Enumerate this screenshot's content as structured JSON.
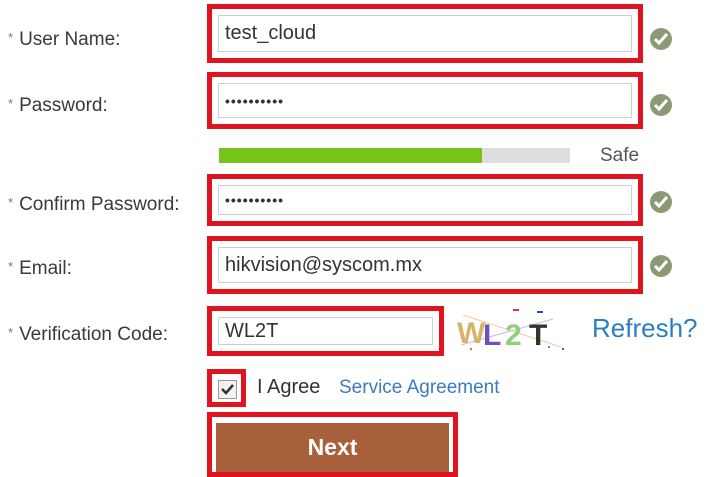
{
  "form": {
    "required_mark": "*",
    "username": {
      "label": "User Name:",
      "value": "test_cloud"
    },
    "password": {
      "label": "Password:",
      "value": "••••••••••"
    },
    "strength": {
      "label": "Safe",
      "level": 0.75,
      "color": "#76c31a"
    },
    "confirm_password": {
      "label": "Confirm Password:",
      "value": "••••••••••"
    },
    "email": {
      "label": "Email:",
      "value": "hikvision@syscom.mx"
    },
    "verification": {
      "label": "Verification Code:",
      "value": "WL2T",
      "captcha_text": "WL2T",
      "refresh_label": "Refresh?"
    },
    "agree": {
      "checked": true,
      "label": "I Agree",
      "link": "Service Agreement"
    },
    "next_label": "Next"
  },
  "colors": {
    "highlight": "#e0141e",
    "ok_icon": "#8a9b74",
    "link": "#2a7fc4",
    "button": "#a8603a"
  },
  "icons": {
    "valid": "check-circle-icon",
    "checkbox": "checkmark-icon"
  }
}
